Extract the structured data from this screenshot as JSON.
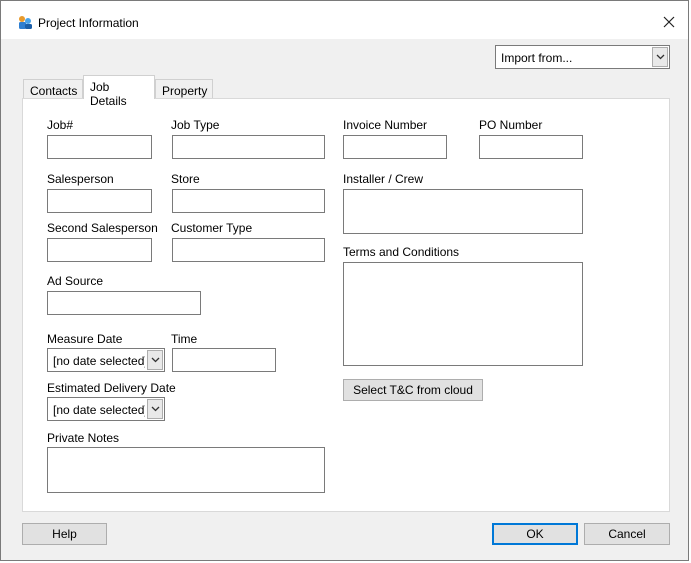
{
  "window": {
    "title": "Project Information"
  },
  "import": {
    "value": "Import from..."
  },
  "tabs": [
    {
      "label": "Contacts"
    },
    {
      "label": "Job Details"
    },
    {
      "label": "Property"
    }
  ],
  "form": {
    "job_number_label": "Job#",
    "job_type_label": "Job Type",
    "invoice_number_label": "Invoice Number",
    "po_number_label": "PO Number",
    "salesperson_label": "Salesperson",
    "store_label": "Store",
    "installer_label": "Installer / Crew",
    "second_salesperson_label": "Second Salesperson",
    "customer_type_label": "Customer Type",
    "terms_label": "Terms and Conditions",
    "ad_source_label": "Ad Source",
    "measure_date_label": "Measure Date",
    "measure_date_value": "[no date selected]",
    "time_label": "Time",
    "estimated_delivery_label": "Estimated Delivery Date",
    "estimated_delivery_value": "[no date selected]",
    "private_notes_label": "Private Notes",
    "select_tc_button": "Select T&C from cloud"
  },
  "footer": {
    "help_button": "Help",
    "ok_button": "OK",
    "cancel_button": "Cancel"
  }
}
